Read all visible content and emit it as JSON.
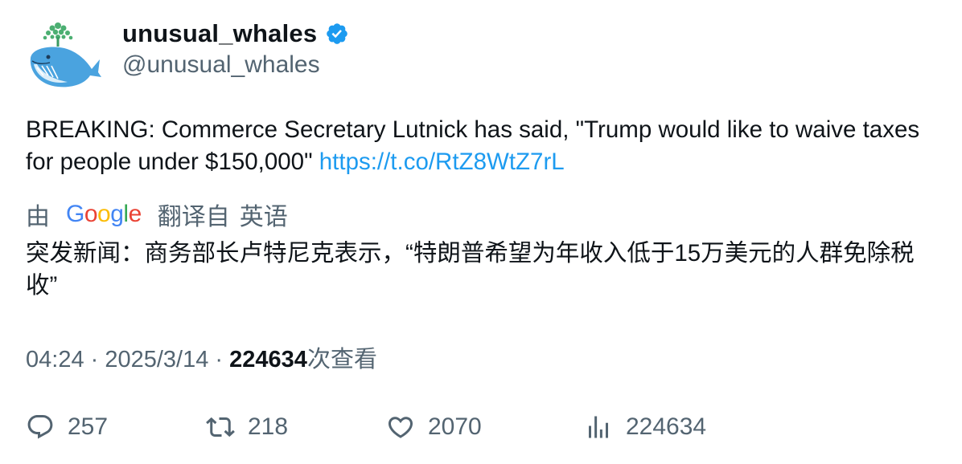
{
  "author": {
    "display_name": "unusual_whales",
    "handle": "@unusual_whales",
    "verified": true,
    "avatar_icon": "whale-logo-icon"
  },
  "tweet": {
    "text": "BREAKING: Commerce Secretary Lutnick has said, \"Trump would like to waive taxes for people under $150,000\" ",
    "link": "https://t.co/RtZ8WtZ7rL"
  },
  "translation": {
    "by_label": "由",
    "google_letters": [
      "G",
      "o",
      "o",
      "g",
      "l",
      "e"
    ],
    "from_label": "翻译自",
    "language": "英语",
    "text": "突发新闻：商务部长卢特尼克表示，“特朗普希望为年收入低于15万美元的人群免除税收”"
  },
  "meta": {
    "time": "04:24",
    "separator": " · ",
    "date": "2025/3/14",
    "views_count": "224634",
    "views_label": "次查看"
  },
  "actions": {
    "replies": "257",
    "retweets": "218",
    "likes": "2070",
    "views": "224634"
  },
  "colors": {
    "link": "#1d9bf0",
    "muted": "#536471",
    "text": "#0f1419",
    "verified_badge": "#1d9bf0"
  }
}
